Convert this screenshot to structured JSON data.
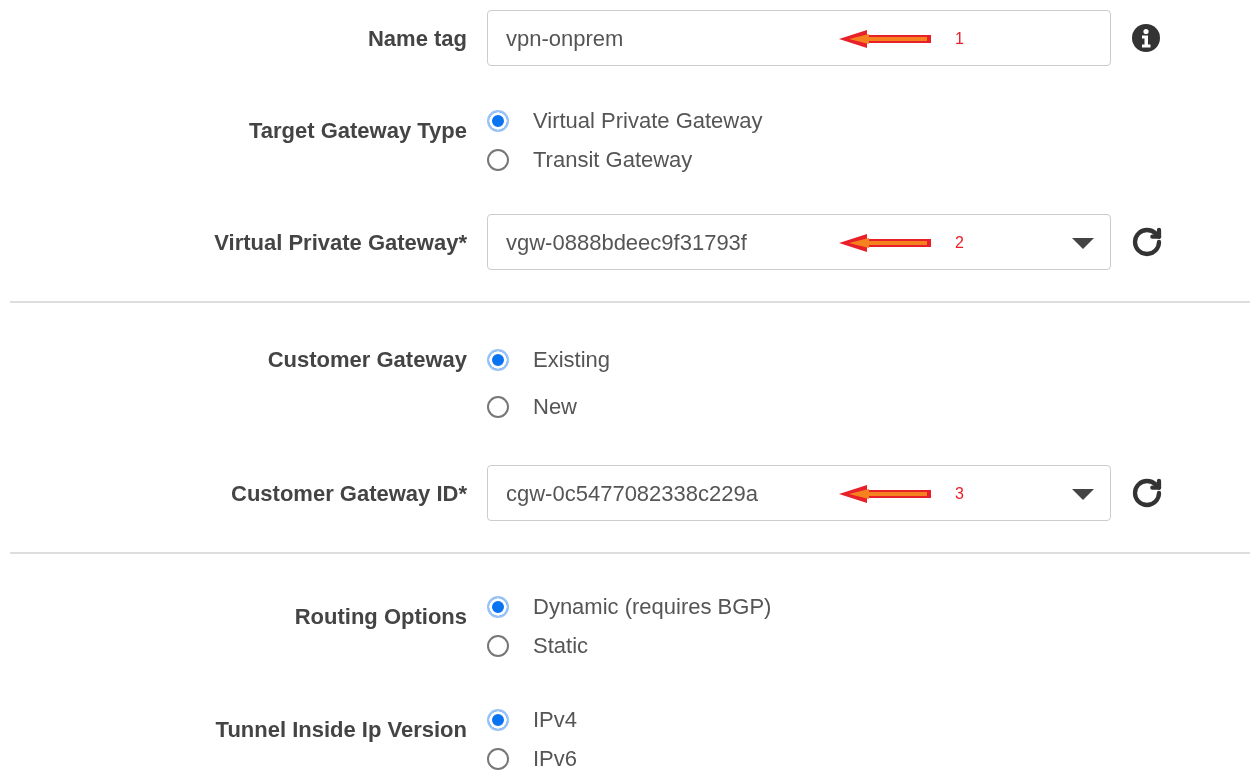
{
  "sections": [
    {
      "rows": [
        {
          "kind": "text",
          "label": "Name tag",
          "value": "vpn-onprem",
          "annotation": "1",
          "button": {
            "kind": "info"
          }
        },
        {
          "kind": "radio",
          "label": "Target Gateway Type",
          "spaced": false,
          "options": [
            {
              "label": "Virtual Private Gateway",
              "selected": true
            },
            {
              "label": "Transit Gateway",
              "selected": false
            }
          ]
        },
        {
          "kind": "select",
          "label": "Virtual Private Gateway*",
          "value": "vgw-0888bdeec9f31793f",
          "annotation": "2",
          "button": {
            "kind": "refresh"
          }
        }
      ]
    },
    {
      "rows": [
        {
          "kind": "radio",
          "label": "Customer Gateway",
          "spaced": true,
          "options": [
            {
              "label": "Existing",
              "selected": true
            },
            {
              "label": "New",
              "selected": false
            }
          ]
        },
        {
          "kind": "select",
          "label": "Customer Gateway ID*",
          "value": "cgw-0c5477082338c229a",
          "annotation": "3",
          "button": {
            "kind": "refresh"
          }
        }
      ]
    },
    {
      "rows": [
        {
          "kind": "radio",
          "label": "Routing Options",
          "spaced": false,
          "options": [
            {
              "label": "Dynamic (requires BGP)",
              "selected": true
            },
            {
              "label": "Static",
              "selected": false
            }
          ]
        },
        {
          "kind": "radio",
          "label": "Tunnel Inside Ip Version",
          "spaced": false,
          "options": [
            {
              "label": "IPv4",
              "selected": true
            },
            {
              "label": "IPv6",
              "selected": false
            }
          ]
        }
      ]
    }
  ]
}
